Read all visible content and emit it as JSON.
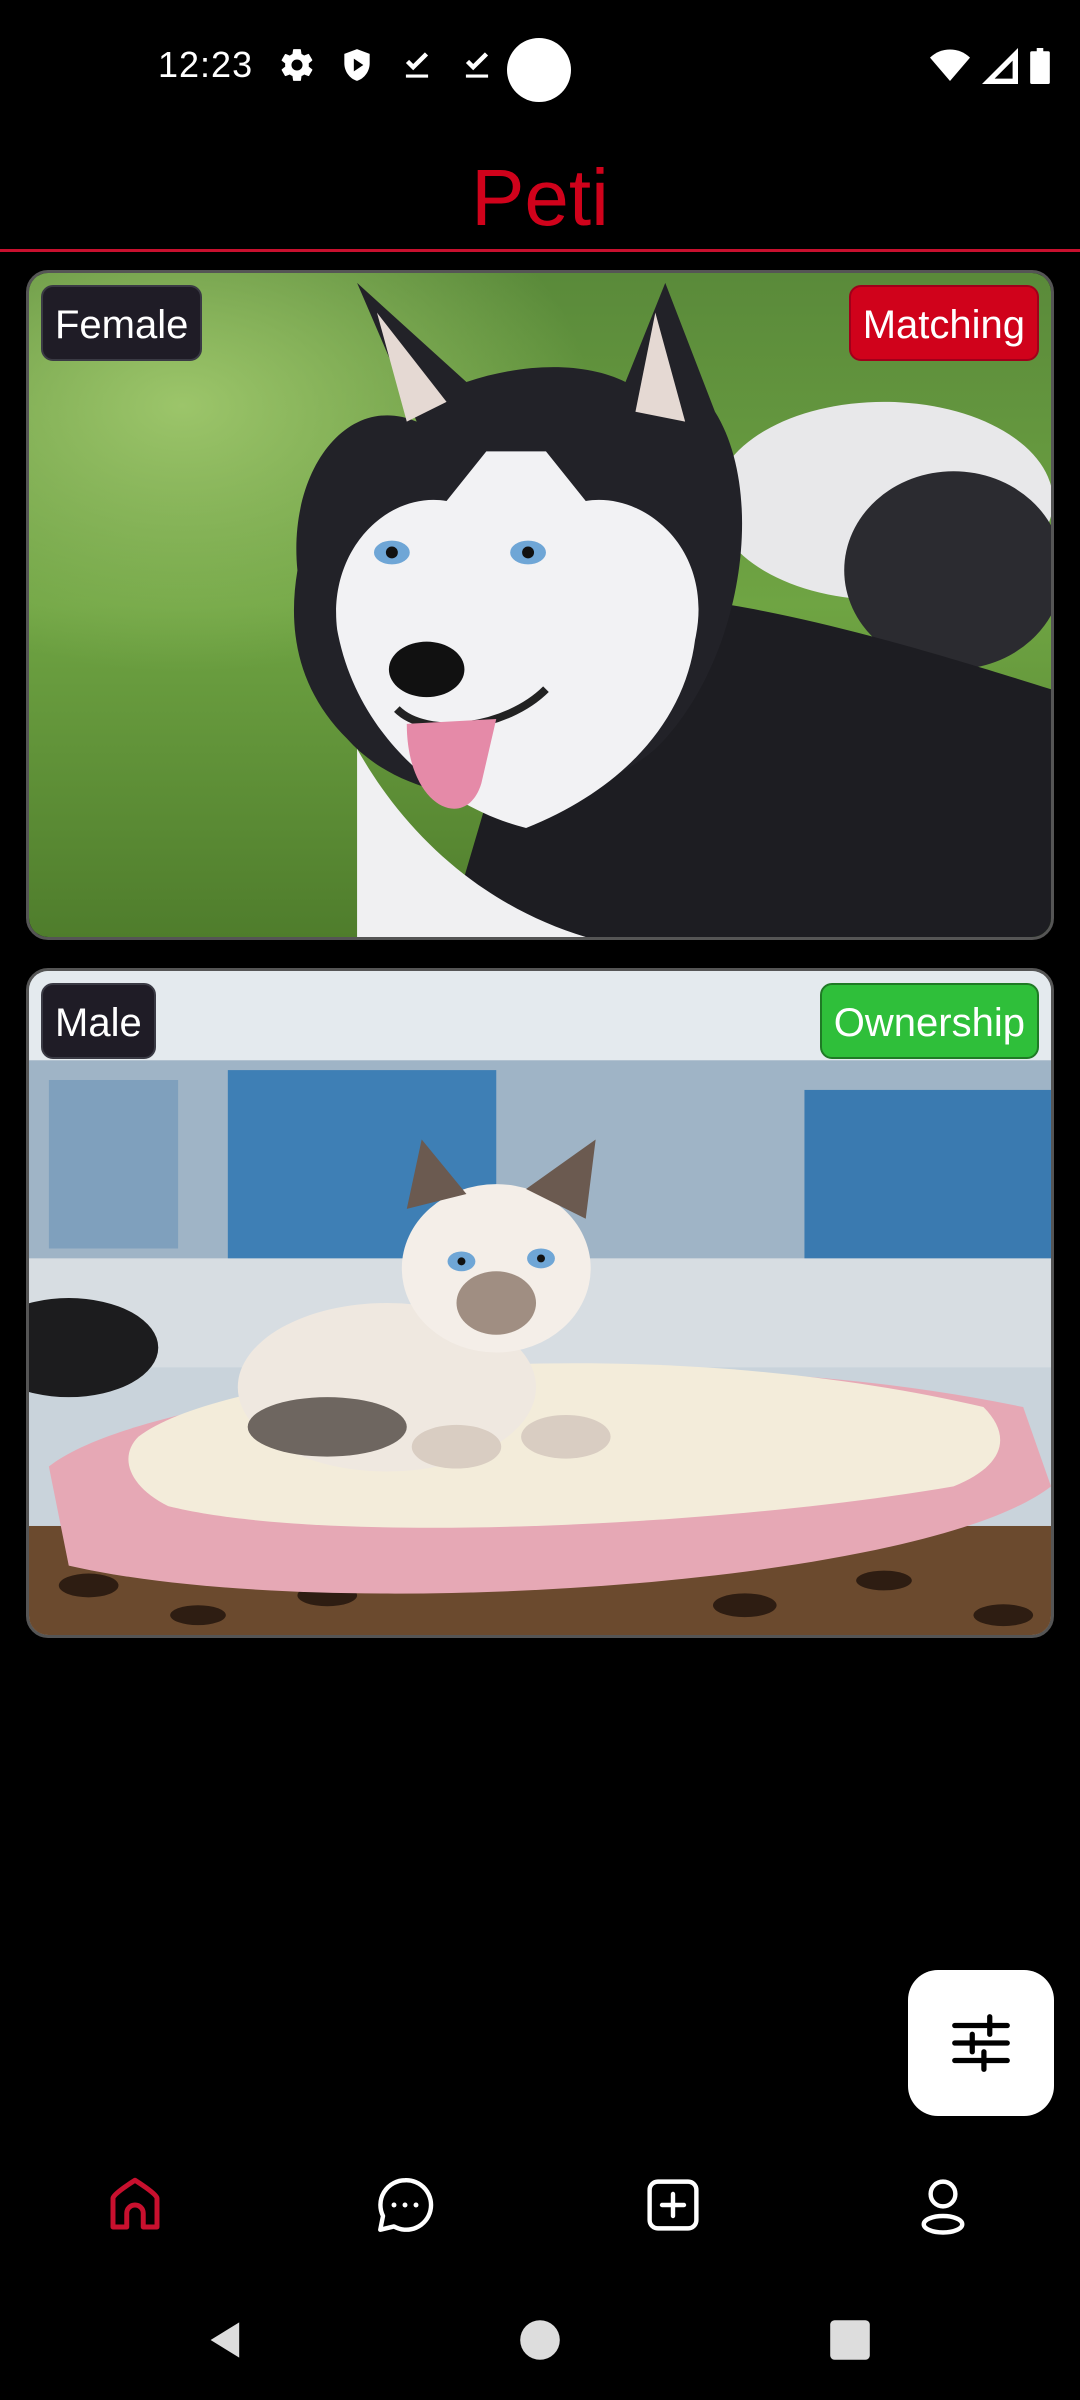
{
  "status_bar": {
    "time": "12:23",
    "icons_left": [
      "gear-icon",
      "shield-icon",
      "download-done-icon",
      "download-done-icon"
    ],
    "icons_right": [
      "wifi-icon",
      "signal-icon",
      "battery-icon"
    ]
  },
  "header": {
    "title": "Peti",
    "accent_color": "#d0021b"
  },
  "cards": [
    {
      "gender": "Female",
      "type": "Matching",
      "type_color": "#d0021b",
      "image": "husky-dog-photo"
    },
    {
      "gender": "Male",
      "type": "Ownership",
      "type_color": "#2fbf3a",
      "image": "siamese-kitten-photo"
    }
  ],
  "fab": {
    "icon": "filter-sliders-icon"
  },
  "bottom_nav": {
    "items": [
      {
        "id": "home",
        "icon": "home-icon",
        "active": true
      },
      {
        "id": "chat",
        "icon": "chat-icon",
        "active": false
      },
      {
        "id": "add",
        "icon": "add-box-icon",
        "active": false
      },
      {
        "id": "profile",
        "icon": "profile-icon",
        "active": false
      }
    ],
    "active_color": "#c8102e",
    "inactive_color": "#ffffff"
  },
  "system_nav": [
    "back-icon",
    "home-circle-icon",
    "recents-icon"
  ]
}
